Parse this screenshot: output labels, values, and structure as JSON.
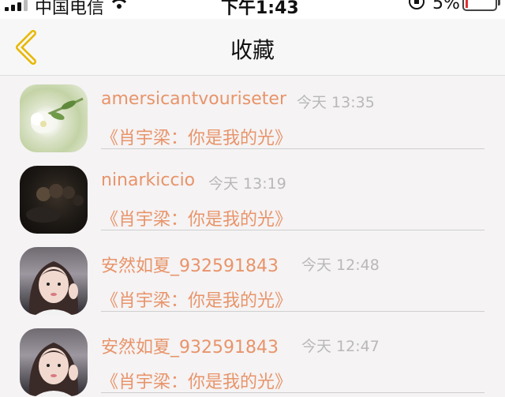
{
  "status_bar": {
    "carrier": "中国电信",
    "time": "下午1:43",
    "battery_percent": "5%"
  },
  "nav": {
    "title": "收藏"
  },
  "items": [
    {
      "username": "amersicantvouriseter",
      "time": "今天 13:35",
      "link": "《肖宇梁：你是我的光》",
      "avatar": "flower-avatar"
    },
    {
      "username": "ninarkiccio",
      "time": "今天 13:19",
      "link": "《肖宇梁：你是我的光》",
      "avatar": "dark-avatar"
    },
    {
      "username": "安然如夏_932591843",
      "time": "今天 12:48",
      "link": "《肖宇梁：你是我的光》",
      "avatar": "girl-avatar"
    },
    {
      "username": "安然如夏_932591843",
      "time": "今天 12:47",
      "link": "《肖宇梁：你是我的光》",
      "avatar": "girl-avatar"
    }
  ],
  "colors": {
    "accent": "#e8946a",
    "back_icon": "#e8b800",
    "muted": "#b8b8b8"
  }
}
